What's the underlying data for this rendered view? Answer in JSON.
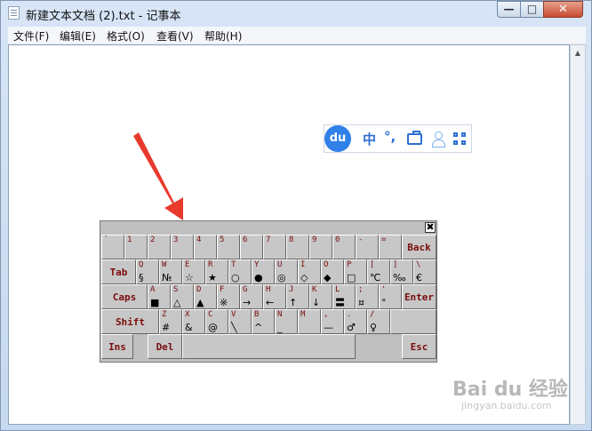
{
  "window": {
    "title": "新建文本文档 (2).txt - 记事本",
    "min_label": "—",
    "max_label": "□",
    "close_label": "✕"
  },
  "menu": {
    "items": [
      "文件(F)",
      "编辑(E)",
      "格式(O)",
      "查看(V)",
      "帮助(H)"
    ]
  },
  "ime": {
    "logo": "du",
    "mode": "中",
    "punct": "°,"
  },
  "keyboard": {
    "close_label": "✖",
    "row1": [
      {
        "l": "`",
        "s": ""
      },
      {
        "l": "1",
        "s": ""
      },
      {
        "l": "2",
        "s": ""
      },
      {
        "l": "3",
        "s": ""
      },
      {
        "l": "4",
        "s": ""
      },
      {
        "l": "5",
        "s": ""
      },
      {
        "l": "6",
        "s": ""
      },
      {
        "l": "7",
        "s": ""
      },
      {
        "l": "8",
        "s": ""
      },
      {
        "l": "9",
        "s": ""
      },
      {
        "l": "0",
        "s": ""
      },
      {
        "l": "-",
        "s": ""
      },
      {
        "l": "=",
        "s": ""
      }
    ],
    "back": "Back",
    "tab": "Tab",
    "row2": [
      {
        "l": "Q",
        "s": "§"
      },
      {
        "l": "W",
        "s": "№"
      },
      {
        "l": "E",
        "s": "☆"
      },
      {
        "l": "R",
        "s": "★"
      },
      {
        "l": "T",
        "s": "○"
      },
      {
        "l": "Y",
        "s": "●"
      },
      {
        "l": "U",
        "s": "◎"
      },
      {
        "l": "I",
        "s": "◇"
      },
      {
        "l": "O",
        "s": "◆"
      },
      {
        "l": "P",
        "s": "□"
      },
      {
        "l": "[",
        "s": "℃"
      },
      {
        "l": "]",
        "s": "‰"
      },
      {
        "l": "\\",
        "s": "€"
      }
    ],
    "caps": "Caps",
    "row3": [
      {
        "l": "A",
        "s": "■"
      },
      {
        "l": "S",
        "s": "△"
      },
      {
        "l": "D",
        "s": "▲"
      },
      {
        "l": "F",
        "s": "※"
      },
      {
        "l": "G",
        "s": "→"
      },
      {
        "l": "H",
        "s": "←"
      },
      {
        "l": "J",
        "s": "↑"
      },
      {
        "l": "K",
        "s": "↓"
      },
      {
        "l": "L",
        "s": "〓"
      },
      {
        "l": ";",
        "s": "¤"
      },
      {
        "l": "'",
        "s": "°"
      }
    ],
    "enter": "Enter",
    "shift": "Shift",
    "row4": [
      {
        "l": "Z",
        "s": "#"
      },
      {
        "l": "X",
        "s": "&"
      },
      {
        "l": "C",
        "s": "@"
      },
      {
        "l": "V",
        "s": "╲"
      },
      {
        "l": "B",
        "s": "^"
      },
      {
        "l": "N",
        "s": "_"
      },
      {
        "l": "M",
        "s": ""
      },
      {
        "l": ",",
        "s": "—"
      },
      {
        "l": ".",
        "s": "♂"
      },
      {
        "l": "/",
        "s": "♀"
      }
    ],
    "ins": "Ins",
    "del": "Del",
    "esc": "Esc"
  },
  "watermark": {
    "text": "Bai du 经验",
    "sub": "jingyan.baidu.com"
  }
}
